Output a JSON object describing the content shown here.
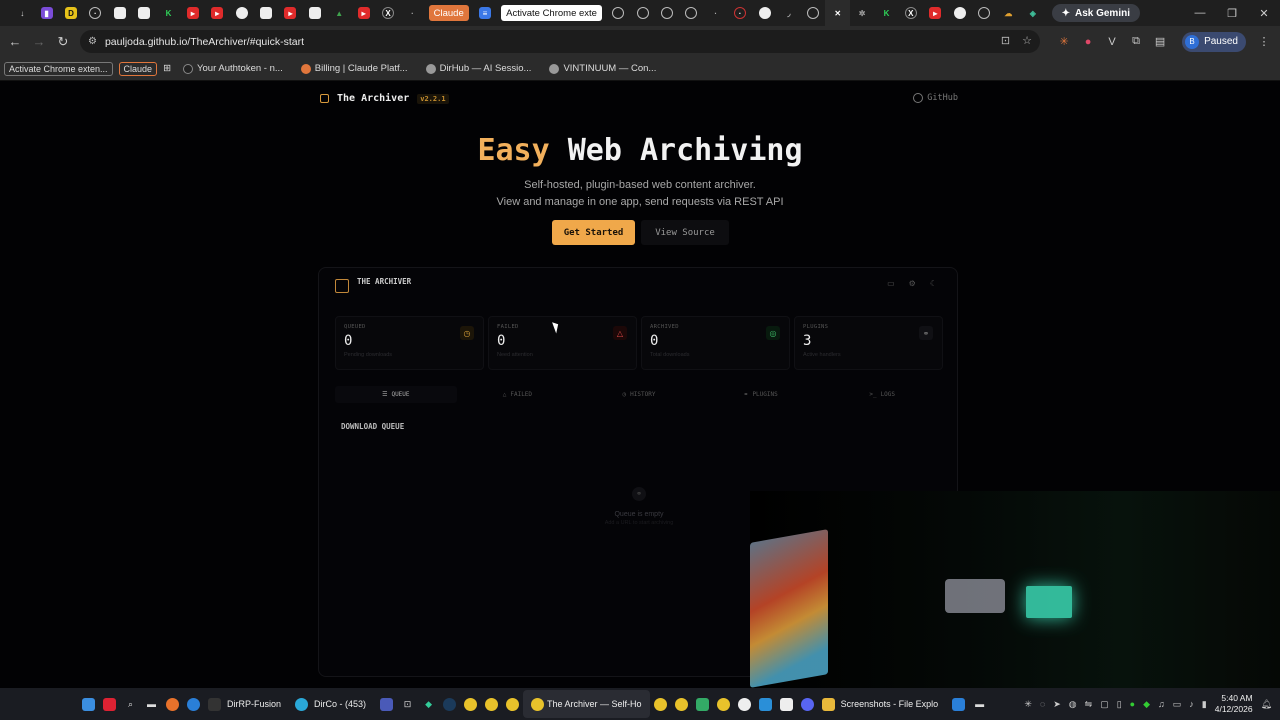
{
  "browser": {
    "tab_pills": {
      "claude": "Claude",
      "activate": "Activate Chrome exte"
    },
    "gemini_label": "Ask Gemini",
    "url": "pauljoda.github.io/TheArchiver/#quick-start",
    "profile_status": "Paused",
    "profile_initial": "B",
    "bookmarks": [
      {
        "label": "Activate Chrome exten..."
      },
      {
        "label": "Claude"
      },
      {
        "label": "Your Authtoken - n..."
      },
      {
        "label": "Billing | Claude Platf..."
      },
      {
        "label": "DirHub — AI Sessio..."
      },
      {
        "label": "VINTINUUM — Con..."
      }
    ]
  },
  "site": {
    "brand_name": "The Archiver",
    "version": "v2.2.1",
    "github_label": "GitHub",
    "hero_title_accent": "Easy",
    "hero_title_rest": " Web Archiving",
    "hero_sub_line1": "Self-hosted, plugin-based web content archiver.",
    "hero_sub_line2": "View and manage in one app, send requests via REST API",
    "primary_button": "Get Started",
    "secondary_button": "View Source"
  },
  "preview": {
    "app_name": "THE ARCHIVER",
    "stats": [
      {
        "label": "QUEUED",
        "value": "0",
        "hint": "Pending downloads",
        "icon": "clock-icon",
        "color": "#d8a13a"
      },
      {
        "label": "FAILED",
        "value": "0",
        "hint": "Need attention",
        "icon": "warning-icon",
        "color": "#e04848"
      },
      {
        "label": "ARCHIVED",
        "value": "0",
        "hint": "Total downloads",
        "icon": "check-icon",
        "color": "#3fbf6a"
      },
      {
        "label": "PLUGINS",
        "value": "3",
        "hint": "Active handlers",
        "icon": "link-icon",
        "color": "#777777"
      }
    ],
    "tabs": [
      {
        "label": "QUEUE",
        "glyph": "☰"
      },
      {
        "label": "FAILED",
        "glyph": "△"
      },
      {
        "label": "HISTORY",
        "glyph": "◷"
      },
      {
        "label": "PLUGINS",
        "glyph": "⚭"
      },
      {
        "label": "LOGS",
        "glyph": ">_"
      }
    ],
    "section_title": "DOWNLOAD QUEUE",
    "empty_title": "Queue is empty",
    "empty_hint": "Add a URL to start archiving"
  },
  "taskbar": {
    "items": [
      {
        "label": "DirRP-Fusion"
      },
      {
        "label": "DirCo - (453)"
      },
      {
        "label": "The Archiver — Self-Ho"
      },
      {
        "label": "Screenshots - File Explo"
      }
    ],
    "time": "5:40 AM",
    "date": "4/12/2026"
  },
  "colors": {
    "accent": "#f0a84a",
    "background": "#020204"
  }
}
